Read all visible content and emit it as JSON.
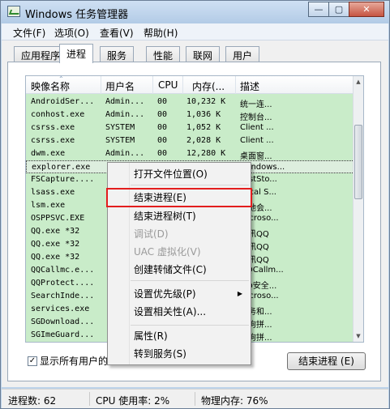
{
  "window": {
    "title": "Windows 任务管理器",
    "buttons": [
      "—",
      "▢",
      "✕"
    ]
  },
  "menubar": {
    "items": [
      "文件(F)",
      "选项(O)",
      "查看(V)",
      "帮助(H)"
    ]
  },
  "tabs": [
    "应用程序",
    "进程",
    "服务",
    "性能",
    "联网",
    "用户"
  ],
  "active_tab": "进程",
  "table": {
    "columns": [
      "映像名称",
      "用户名",
      "CPU",
      "内存(...",
      "描述"
    ],
    "rows": [
      {
        "name": "AndroidSer...",
        "user": "Admin...",
        "cpu": "00",
        "mem": "10,232 K",
        "desc": "统一连..."
      },
      {
        "name": "conhost.exe",
        "user": "Admin...",
        "cpu": "00",
        "mem": "1,036 K",
        "desc": "控制台..."
      },
      {
        "name": "csrss.exe",
        "user": "SYSTEM",
        "cpu": "00",
        "mem": "1,052 K",
        "desc": "Client ..."
      },
      {
        "name": "csrss.exe",
        "user": "SYSTEM",
        "cpu": "00",
        "mem": "2,028 K",
        "desc": "Client ..."
      },
      {
        "name": "dwm.exe",
        "user": "Admin...",
        "cpu": "00",
        "mem": "12,280 K",
        "desc": "桌面窗..."
      },
      {
        "name": "explorer.exe",
        "user": "",
        "cpu": "",
        "mem": "",
        "desc": "Windows..."
      },
      {
        "name": "FSCapture....",
        "user": "",
        "cpu": "",
        "mem": "",
        "desc": "FastSto..."
      },
      {
        "name": "lsass.exe",
        "user": "",
        "cpu": "",
        "mem": "",
        "desc": "Local S..."
      },
      {
        "name": "lsm.exe",
        "user": "",
        "cpu": "",
        "mem": "",
        "desc": "本地会..."
      },
      {
        "name": "OSPPSVC.EXE",
        "user": "",
        "cpu": "",
        "mem": "",
        "desc": "Microso..."
      },
      {
        "name": "QQ.exe *32",
        "user": "",
        "cpu": "",
        "mem": "",
        "desc": "腾讯QQ"
      },
      {
        "name": "QQ.exe *32",
        "user": "",
        "cpu": "",
        "mem": "",
        "desc": "腾讯QQ"
      },
      {
        "name": "QQ.exe *32",
        "user": "",
        "cpu": "",
        "mem": "",
        "desc": "腾讯QQ"
      },
      {
        "name": "QQCallmc.e...",
        "user": "",
        "cpu": "",
        "mem": "",
        "desc": "QQCallm..."
      },
      {
        "name": "QQProtect....",
        "user": "",
        "cpu": "",
        "mem": "",
        "desc": "QQ安全..."
      },
      {
        "name": "SearchInde...",
        "user": "",
        "cpu": "",
        "mem": "",
        "desc": "Microso..."
      },
      {
        "name": "services.exe",
        "user": "",
        "cpu": "",
        "mem": "",
        "desc": "服务和..."
      },
      {
        "name": "SGDownload...",
        "user": "",
        "cpu": "",
        "mem": "",
        "desc": "搜狗拼..."
      },
      {
        "name": "SGImeGuard...",
        "user": "",
        "cpu": "",
        "mem": "",
        "desc": "搜狗拼..."
      }
    ],
    "selected_index": 5
  },
  "context_menu": {
    "items": [
      {
        "label": "打开文件位置(O)",
        "disabled": false
      },
      {
        "label": "结束进程(E)",
        "disabled": false,
        "highlight": true
      },
      {
        "label": "结束进程树(T)",
        "disabled": false
      },
      {
        "label": "调试(D)",
        "disabled": true
      },
      {
        "label": "UAC 虚拟化(V)",
        "disabled": true
      },
      {
        "label": "创建转储文件(C)",
        "disabled": false
      },
      {
        "label": "设置优先级(P)",
        "disabled": false,
        "submenu": true
      },
      {
        "label": "设置相关性(A)...",
        "disabled": false
      },
      {
        "label": "属性(R)",
        "disabled": false
      },
      {
        "label": "转到服务(S)",
        "disabled": false
      }
    ]
  },
  "show_all_label": "显示所有用户的",
  "end_process_button": "结束进程 (E)",
  "status": {
    "processes": "进程数: 62",
    "cpu": "CPU 使用率: 2%",
    "memory": "物理内存: 76%"
  },
  "colors": {
    "list_bg": "#c9ecc9",
    "highlight_border": "#e31d1d"
  }
}
